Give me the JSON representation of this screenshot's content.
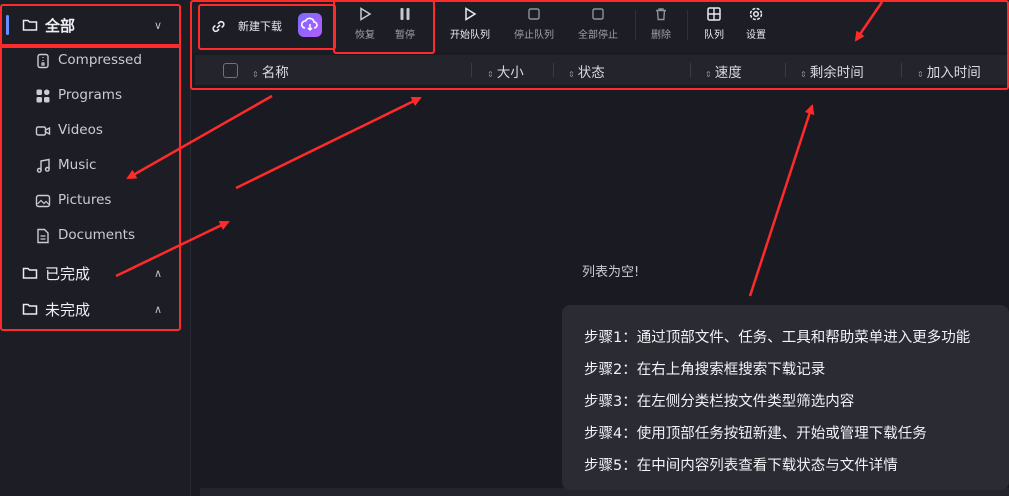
{
  "sidebar": {
    "all": {
      "label": "全部",
      "icon": "folder-icon"
    },
    "subitems": [
      {
        "label": "Compressed",
        "icon": "archive-icon"
      },
      {
        "label": "Programs",
        "icon": "apps-icon"
      },
      {
        "label": "Videos",
        "icon": "video-icon"
      },
      {
        "label": "Music",
        "icon": "music-icon"
      },
      {
        "label": "Pictures",
        "icon": "picture-icon"
      },
      {
        "label": "Documents",
        "icon": "document-icon"
      }
    ],
    "completed": {
      "label": "已完成",
      "icon": "folder-icon"
    },
    "incomplete": {
      "label": "未完成",
      "icon": "folder-icon"
    }
  },
  "toolbar": {
    "new_download": "新建下载",
    "resume": "恢复",
    "pause": "暂停",
    "start_queue": "开始队列",
    "stop_queue": "停止队列",
    "stop_all": "全部停止",
    "delete": "删除",
    "queue": "队列",
    "settings": "设置"
  },
  "columns": [
    "名称",
    "大小",
    "状态",
    "速度",
    "剩余时间",
    "加入时间"
  ],
  "empty_text": "列表为空!",
  "steps": [
    "步骤1：通过顶部文件、任务、工具和帮助菜单进入更多功能",
    "步骤2：在右上角搜索框搜索下载记录",
    "步骤3：在左侧分类栏按文件类型筛选内容",
    "步骤4：使用顶部任务按钮新建、开始或管理下载任务",
    "步骤5：在中间内容列表查看下载状态与文件详情"
  ],
  "colors": {
    "annotation_red": "#ff2b2b",
    "accent": "#6b8cff",
    "background": "#1a1b22"
  }
}
